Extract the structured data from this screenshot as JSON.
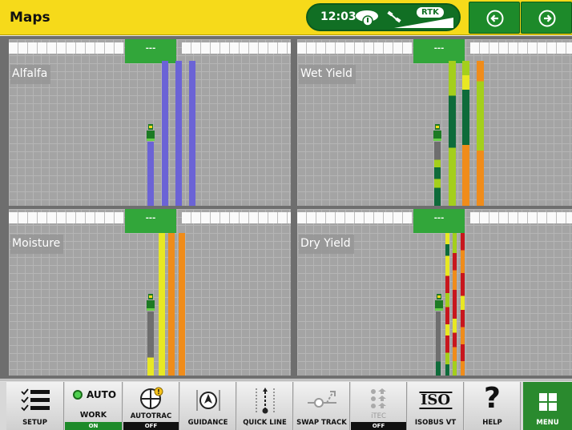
{
  "header": {
    "title": "Maps",
    "time": "12:03",
    "rtk": "RTK",
    "icons": [
      "cloud-signal-icon",
      "satellite-icon",
      "signal-strength-icon"
    ]
  },
  "nav": {
    "back_icon": "arrow-left-circle-icon",
    "forward_icon": "arrow-right-circle-icon"
  },
  "panels": [
    {
      "label": "Alfalfa",
      "boom_indicator": "---"
    },
    {
      "label": "Wet Yield",
      "boom_indicator": "---"
    },
    {
      "label": "Moisture",
      "boom_indicator": "---"
    },
    {
      "label": "Dry Yield",
      "boom_indicator": "---"
    }
  ],
  "colors": {
    "header": "#f6da1a",
    "brand_green": "#1d8a2a",
    "active_boom": "#32a63a",
    "alfalfa": "#6b63d6",
    "yield_dark": "#0e6b3a",
    "yield_lime": "#a4cf1c",
    "yield_yellow": "#e8e823",
    "yield_orange": "#f08c1a",
    "yield_red": "#c8161d"
  },
  "toolbar": {
    "setup": "SETUP",
    "work_auto": "AUTO",
    "work": "WORK",
    "work_state": "ON",
    "autotrac": "AUTOTRAC",
    "autotrac_state": "OFF",
    "guidance": "GUIDANCE",
    "quick_line": "QUICK LINE",
    "swap_track": "SWAP TRACK",
    "itec": "iTEC",
    "itec_state": "OFF",
    "iso_badge": "ISO",
    "isobus": "ISOBUS VT",
    "help": "HELP",
    "menu": "MENU"
  }
}
